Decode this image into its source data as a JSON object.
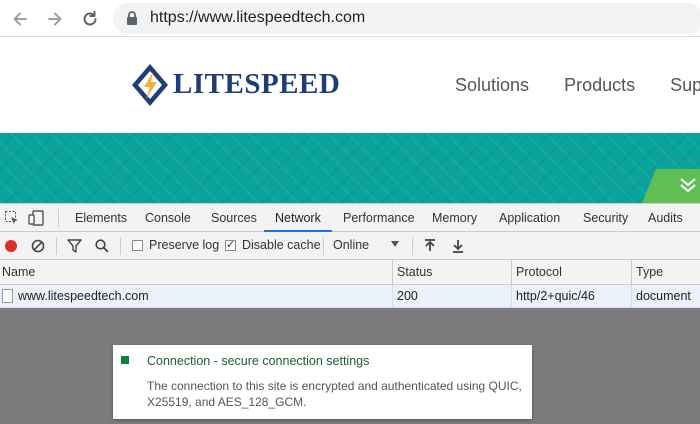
{
  "browser": {
    "url": "https://www.litespeedtech.com",
    "icons": [
      "back-arrow-icon",
      "forward-arrow-icon",
      "reload-icon",
      "lock-icon"
    ]
  },
  "site": {
    "logo_text": "LITESPEED",
    "nav": [
      "Solutions",
      "Products",
      "Suppor"
    ],
    "colors": {
      "brand_blue": "#1f3e78",
      "brand_yellow": "#f2b535",
      "teal": "#0aa39c",
      "green_accent": "#5fbf55"
    }
  },
  "devtools": {
    "tabs": [
      "Elements",
      "Console",
      "Sources",
      "Network",
      "Performance",
      "Memory",
      "Application",
      "Security",
      "Audits"
    ],
    "active_tab": "Network",
    "toolbar": {
      "preserve_log_label": "Preserve log",
      "preserve_log_checked": false,
      "disable_cache_label": "Disable cache",
      "disable_cache_checked": true,
      "throttle_value": "Online"
    },
    "columns": [
      "Name",
      "Status",
      "Protocol",
      "Type"
    ],
    "rows": [
      {
        "name": "www.litespeedtech.com",
        "status": "200",
        "protocol": "http/2+quic/46",
        "type": "document"
      }
    ]
  },
  "popup": {
    "title": "Connection - secure connection settings",
    "body": "The connection to this site is encrypted and authenticated using QUIC, X25519, and AES_128_GCM.",
    "status_color": "#0b8043"
  }
}
